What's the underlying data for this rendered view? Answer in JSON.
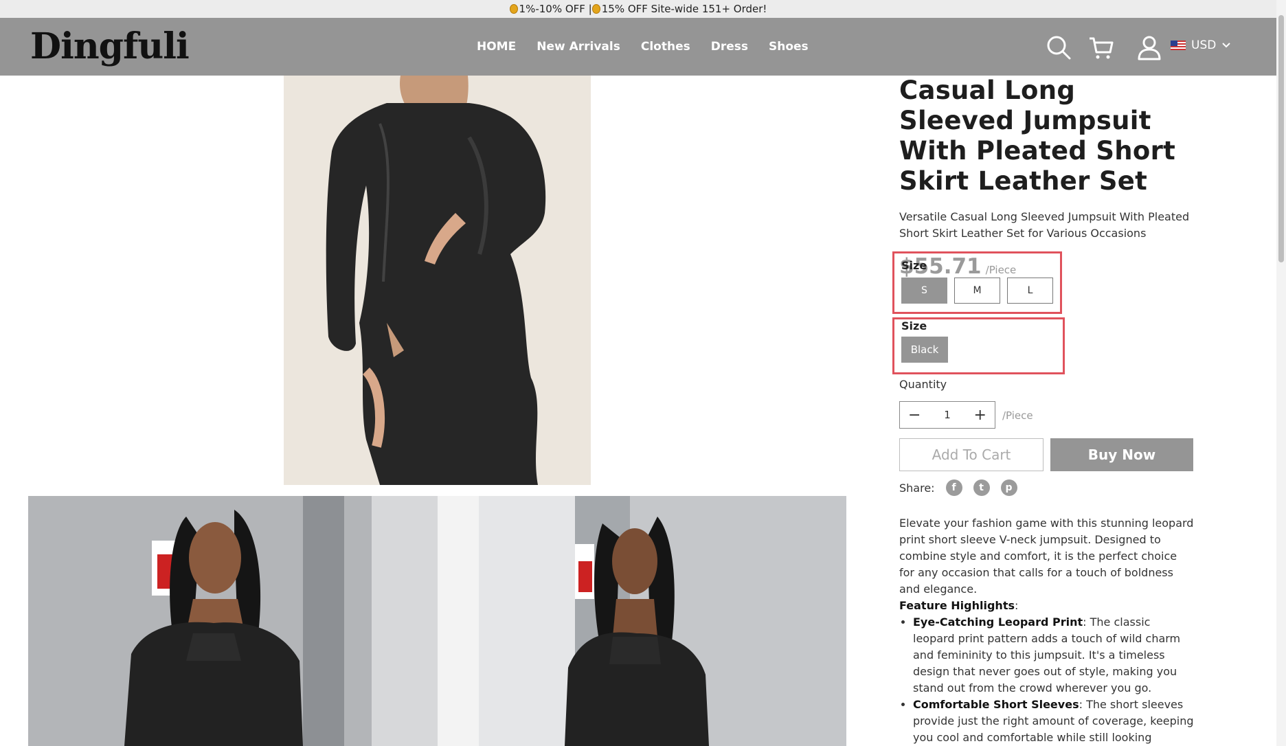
{
  "announcement": {
    "part1": "1%-10% OFF |",
    "part2": "15% OFF Site-wide 151+ Order!"
  },
  "header": {
    "logo": "Dingfuli",
    "nav": [
      "HOME",
      "New Arrivals",
      "Clothes",
      "Dress",
      "Shoes"
    ],
    "icons": [
      "search-icon",
      "cart-icon",
      "user-icon"
    ],
    "currency": "USD"
  },
  "product": {
    "title": "Casual Long Sleeved Jumpsuit With Pleated Short Skirt Leather Set",
    "subtitle": "Versatile Casual Long Sleeved Jumpsuit With Pleated Short Skirt Leather Set for Various Occasions",
    "price": "$55.71",
    "price_unit": "/Piece",
    "option1_label": "Size",
    "sizes": [
      "S",
      "M",
      "L"
    ],
    "selected_size": "S",
    "option2_label": "Size",
    "colors": [
      "Black"
    ],
    "quantity_label": "Quantity",
    "quantity": "1",
    "quantity_unit": "/Piece",
    "add_to_cart": "Add To Cart",
    "buy_now": "Buy Now",
    "share_label": "Share:",
    "share_icons": [
      "facebook-icon",
      "twitter-icon",
      "pinterest-icon"
    ]
  },
  "description": {
    "intro": "Elevate your fashion game with this stunning leopard print short sleeve V-neck jumpsuit. Designed to combine style and comfort, it is the perfect choice for any occasion that calls for a touch of boldness and elegance.",
    "highlights_title": "Feature Highlights",
    "highlights": [
      {
        "title": "Eye-Catching Leopard Print",
        "text": ": The classic leopard print pattern adds a touch of wild charm and femininity to this jumpsuit. It's a timeless design that never goes out of style, making you stand out from the crowd wherever you go."
      },
      {
        "title": "Comfortable Short Sleeves",
        "text": ": The short sleeves provide just the right amount of coverage, keeping you cool and comfortable while still looking"
      }
    ]
  }
}
